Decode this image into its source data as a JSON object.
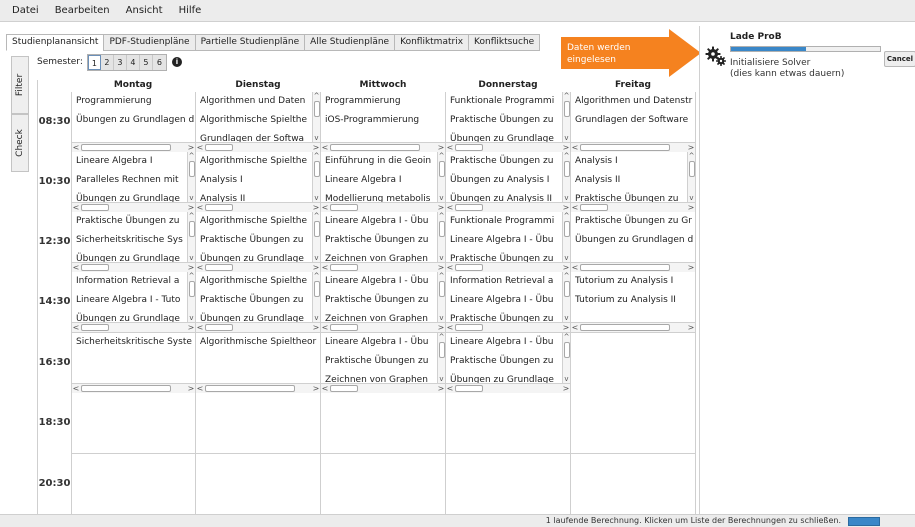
{
  "menu": [
    "Datei",
    "Bearbeiten",
    "Ansicht",
    "Hilfe"
  ],
  "tabs": [
    "Studienplanansicht",
    "PDF-Studienpläne",
    "Partielle Studienpläne",
    "Alle Studienpläne",
    "Konfliktmatrix",
    "Konfliktsuche"
  ],
  "side_tabs": [
    "Filter",
    "Check"
  ],
  "semester": {
    "label": "Semester:",
    "options": [
      "1",
      "2",
      "3",
      "4",
      "5",
      "6"
    ],
    "selected": "1",
    "info_icon": "info-icon"
  },
  "days": [
    "Montag",
    "Dienstag",
    "Mittwoch",
    "Donnerstag",
    "Freitag"
  ],
  "times": [
    "08:30",
    "10:30",
    "12:30",
    "14:30",
    "16:30",
    "18:30",
    "20:30"
  ],
  "schedule": [
    [
      [
        "Programmierung",
        "Übungen zu Grundlagen d"
      ],
      [
        "Algorithmen und Daten",
        "Algorithmische Spielthe",
        "Grundlagen der Softwa"
      ],
      [
        "Programmierung",
        "iOS-Programmierung"
      ],
      [
        "Funktionale Programmi",
        "Praktische Übungen zu",
        "Übungen zu Grundlage"
      ],
      [
        "Algorithmen und Datenstr",
        "Grundlagen der Software"
      ]
    ],
    [
      [
        "Lineare Algebra I",
        "Paralleles Rechnen mit",
        "Übungen zu Grundlage"
      ],
      [
        "Algorithmische Spielthe",
        "Analysis I",
        "Analysis II"
      ],
      [
        "Einführung in die Geoin",
        "Lineare Algebra I",
        "Modellierung metabolis"
      ],
      [
        "Praktische Übungen zu",
        "Übungen zu Analysis I",
        "Übungen zu Analysis II"
      ],
      [
        "Analysis I",
        "Analysis II",
        "Praktische Übungen zu"
      ]
    ],
    [
      [
        "Praktische Übungen zu",
        "Sicherheitskritische Sys",
        "Übungen zu Grundlage"
      ],
      [
        "Algorithmische Spielthe",
        "Praktische Übungen zu",
        "Übungen zu Grundlage"
      ],
      [
        "Lineare Algebra I - Übu",
        "Praktische Übungen zu",
        "Zeichnen von Graphen"
      ],
      [
        "Funktionale Programmi",
        "Lineare Algebra I - Übu",
        "Praktische Übungen zu"
      ],
      [
        "Praktische Übungen zu Gr",
        "Übungen zu Grundlagen d"
      ]
    ],
    [
      [
        "Information Retrieval a",
        "Lineare Algebra I - Tuto",
        "Übungen zu Grundlage"
      ],
      [
        "Algorithmische Spielthe",
        "Praktische Übungen zu",
        "Übungen zu Grundlage"
      ],
      [
        "Lineare Algebra I - Übu",
        "Praktische Übungen zu",
        "Zeichnen von Graphen"
      ],
      [
        "Information Retrieval a",
        "Lineare Algebra I - Übu",
        "Praktische Übungen zu"
      ],
      [
        "Tutorium zu Analysis I",
        "Tutorium zu Analysis II"
      ]
    ],
    [
      [
        "Sicherheitskritische Syste"
      ],
      [
        "Algorithmische Spieltheor"
      ],
      [
        "Lineare Algebra I - Übu",
        "Praktische Übungen zu",
        "Zeichnen von Graphen"
      ],
      [
        "Lineare Algebra I - Übu",
        "Praktische Übungen zu",
        "Übungen zu Grundlage"
      ],
      []
    ],
    [
      [],
      [],
      [],
      [],
      []
    ],
    [
      [],
      [],
      [],
      [],
      []
    ]
  ],
  "progress_panel": {
    "title": "Lade ProB",
    "message_line1": "Initialisiere Solver",
    "message_line2": "(dies kann etwas dauern)",
    "cancel_label": "Cancel",
    "progress": 0.5,
    "icon": "gears-icon"
  },
  "callout": {
    "line1": "Daten werden",
    "line2": "eingelesen",
    "color": "#f5821f"
  },
  "status": {
    "text": "1 laufende Berechnung. Klicken um Liste der Berechnungen zu schließen."
  },
  "colors": {
    "accent": "#3a87c8",
    "callout": "#f5821f"
  }
}
